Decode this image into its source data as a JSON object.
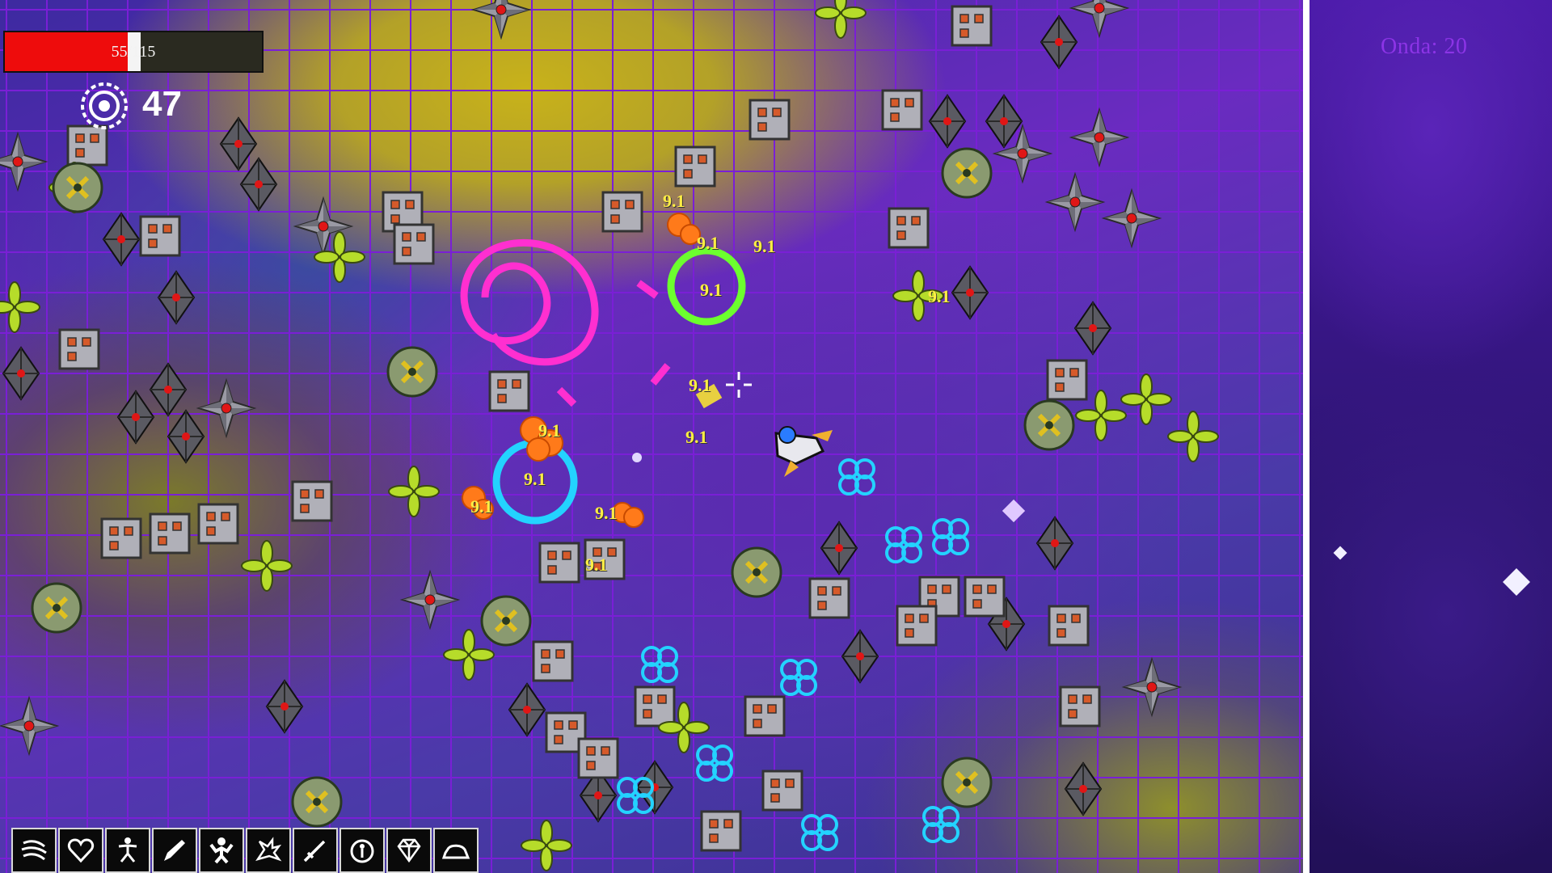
{
  "hud": {
    "health": {
      "current": 55,
      "max": 115,
      "label": "55/115"
    },
    "kills": {
      "count": "47",
      "icon": "target-gear-icon"
    }
  },
  "sidebar": {
    "wave_label": "Onda: 20"
  },
  "damage_numbers": [
    "9.1",
    "9.1",
    "9.1",
    "9.1",
    "9.1",
    "9.1",
    "9.1",
    "9.1",
    "9.1",
    "9.1",
    "9.1",
    "9.1"
  ],
  "hotbar": [
    {
      "icon": "dash-lines-icon"
    },
    {
      "icon": "heart-icon"
    },
    {
      "icon": "runner-icon"
    },
    {
      "icon": "pencil-icon"
    },
    {
      "icon": "strongman-icon"
    },
    {
      "icon": "dragon-icon"
    },
    {
      "icon": "sword-icon"
    },
    {
      "icon": "shield-figure-icon"
    },
    {
      "icon": "gem-icon"
    },
    {
      "icon": "iron-icon"
    }
  ],
  "colors": {
    "health_fill": "#ee0c0c",
    "grid_line": "#7a1fd6",
    "wave_label": "#8c34e6",
    "damage_text": "#ffee44",
    "magenta_ring": "#ff2fd0",
    "green_ring": "#6cff2e",
    "cyan_ring": "#23d3ff",
    "orange_blob": "#ff7a1a"
  }
}
